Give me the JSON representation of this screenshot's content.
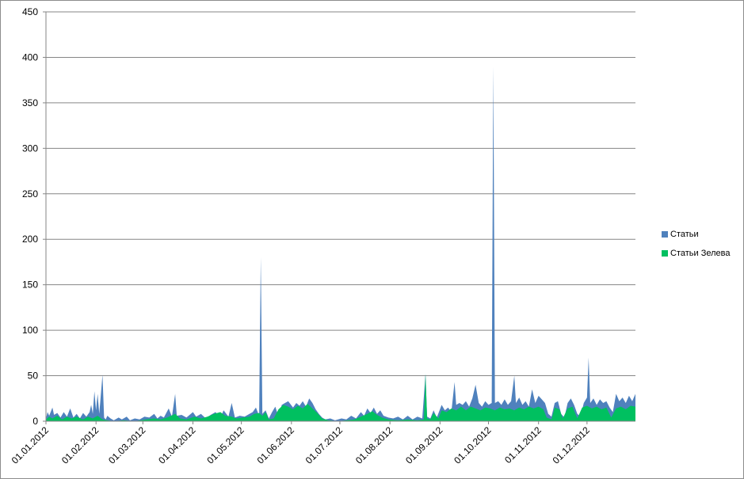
{
  "chart_data": {
    "type": "area",
    "title": "",
    "xlabel": "",
    "ylabel": "",
    "ylim": [
      0,
      450
    ],
    "yticks": [
      0,
      50,
      100,
      150,
      200,
      250,
      300,
      350,
      400,
      450
    ],
    "xlim": [
      "2012-01-01",
      "2012-12-31"
    ],
    "xticks": [
      "01.01.2012",
      "01.02.2012",
      "01.03.2012",
      "01.04.2012",
      "01.05.2012",
      "01.06.2012",
      "01.07.2012",
      "01.08.2012",
      "01.09.2012",
      "01.10.2012",
      "01.11.2012",
      "01.12.2012"
    ],
    "grid": true,
    "legend_position": "right",
    "series": [
      {
        "name": "Статьи",
        "color": "#4f81bd",
        "points": [
          [
            "2012-01-01",
            3
          ],
          [
            "2012-01-02",
            10
          ],
          [
            "2012-01-03",
            6
          ],
          [
            "2012-01-05",
            15
          ],
          [
            "2012-01-06",
            7
          ],
          [
            "2012-01-08",
            9
          ],
          [
            "2012-01-10",
            4
          ],
          [
            "2012-01-12",
            10
          ],
          [
            "2012-01-14",
            5
          ],
          [
            "2012-01-16",
            14
          ],
          [
            "2012-01-18",
            4
          ],
          [
            "2012-01-20",
            8
          ],
          [
            "2012-01-22",
            3
          ],
          [
            "2012-01-24",
            9
          ],
          [
            "2012-01-26",
            5
          ],
          [
            "2012-01-28",
            10
          ],
          [
            "2012-01-29",
            18
          ],
          [
            "2012-01-30",
            8
          ],
          [
            "2012-01-31",
            33
          ],
          [
            "2012-02-01",
            12
          ],
          [
            "2012-02-02",
            30
          ],
          [
            "2012-02-03",
            8
          ],
          [
            "2012-02-05",
            51
          ],
          [
            "2012-02-06",
            4
          ],
          [
            "2012-02-07",
            2
          ],
          [
            "2012-02-08",
            6
          ],
          [
            "2012-02-10",
            3
          ],
          [
            "2012-02-12",
            1
          ],
          [
            "2012-02-15",
            4
          ],
          [
            "2012-02-17",
            2
          ],
          [
            "2012-02-20",
            5
          ],
          [
            "2012-02-22",
            1
          ],
          [
            "2012-02-25",
            3
          ],
          [
            "2012-02-28",
            2
          ],
          [
            "2012-03-02",
            5
          ],
          [
            "2012-03-05",
            4
          ],
          [
            "2012-03-08",
            8
          ],
          [
            "2012-03-10",
            3
          ],
          [
            "2012-03-12",
            6
          ],
          [
            "2012-03-14",
            4
          ],
          [
            "2012-03-17",
            14
          ],
          [
            "2012-03-19",
            5
          ],
          [
            "2012-03-21",
            30
          ],
          [
            "2012-03-22",
            6
          ],
          [
            "2012-03-25",
            7
          ],
          [
            "2012-03-28",
            4
          ],
          [
            "2012-04-01",
            10
          ],
          [
            "2012-04-03",
            5
          ],
          [
            "2012-04-06",
            8
          ],
          [
            "2012-04-09",
            3
          ],
          [
            "2012-04-12",
            7
          ],
          [
            "2012-04-15",
            10
          ],
          [
            "2012-04-18",
            4
          ],
          [
            "2012-04-20",
            12
          ],
          [
            "2012-04-23",
            5
          ],
          [
            "2012-04-25",
            20
          ],
          [
            "2012-04-27",
            4
          ],
          [
            "2012-04-30",
            6
          ],
          [
            "2012-05-03",
            5
          ],
          [
            "2012-05-06",
            8
          ],
          [
            "2012-05-08",
            10
          ],
          [
            "2012-05-10",
            15
          ],
          [
            "2012-05-12",
            6
          ],
          [
            "2012-05-13",
            180
          ],
          [
            "2012-05-14",
            8
          ],
          [
            "2012-05-16",
            12
          ],
          [
            "2012-05-18",
            3
          ],
          [
            "2012-05-20",
            10
          ],
          [
            "2012-05-22",
            16
          ],
          [
            "2012-05-24",
            5
          ],
          [
            "2012-05-26",
            18
          ],
          [
            "2012-05-28",
            20
          ],
          [
            "2012-05-30",
            22
          ],
          [
            "2012-06-02",
            15
          ],
          [
            "2012-06-04",
            20
          ],
          [
            "2012-06-06",
            17
          ],
          [
            "2012-06-08",
            22
          ],
          [
            "2012-06-10",
            16
          ],
          [
            "2012-06-12",
            25
          ],
          [
            "2012-06-14",
            20
          ],
          [
            "2012-06-16",
            13
          ],
          [
            "2012-06-18",
            8
          ],
          [
            "2012-06-20",
            4
          ],
          [
            "2012-06-22",
            2
          ],
          [
            "2012-06-25",
            3
          ],
          [
            "2012-06-28",
            1
          ],
          [
            "2012-07-02",
            3
          ],
          [
            "2012-07-05",
            2
          ],
          [
            "2012-07-08",
            6
          ],
          [
            "2012-07-11",
            3
          ],
          [
            "2012-07-14",
            10
          ],
          [
            "2012-07-16",
            6
          ],
          [
            "2012-07-18",
            14
          ],
          [
            "2012-07-20",
            9
          ],
          [
            "2012-07-22",
            15
          ],
          [
            "2012-07-24",
            8
          ],
          [
            "2012-07-26",
            12
          ],
          [
            "2012-07-28",
            6
          ],
          [
            "2012-07-31",
            4
          ],
          [
            "2012-08-03",
            3
          ],
          [
            "2012-08-06",
            5
          ],
          [
            "2012-08-09",
            2
          ],
          [
            "2012-08-12",
            6
          ],
          [
            "2012-08-15",
            2
          ],
          [
            "2012-08-18",
            5
          ],
          [
            "2012-08-21",
            3
          ],
          [
            "2012-08-23",
            52
          ],
          [
            "2012-08-24",
            5
          ],
          [
            "2012-08-26",
            3
          ],
          [
            "2012-08-28",
            12
          ],
          [
            "2012-08-30",
            4
          ],
          [
            "2012-09-02",
            18
          ],
          [
            "2012-09-04",
            12
          ],
          [
            "2012-09-06",
            15
          ],
          [
            "2012-09-08",
            10
          ],
          [
            "2012-09-10",
            43
          ],
          [
            "2012-09-11",
            18
          ],
          [
            "2012-09-13",
            20
          ],
          [
            "2012-09-15",
            18
          ],
          [
            "2012-09-17",
            22
          ],
          [
            "2012-09-19",
            16
          ],
          [
            "2012-09-21",
            25
          ],
          [
            "2012-09-23",
            40
          ],
          [
            "2012-09-25",
            20
          ],
          [
            "2012-09-27",
            16
          ],
          [
            "2012-09-29",
            22
          ],
          [
            "2012-10-01",
            18
          ],
          [
            "2012-10-03",
            20
          ],
          [
            "2012-10-04",
            390
          ],
          [
            "2012-10-05",
            20
          ],
          [
            "2012-10-07",
            22
          ],
          [
            "2012-10-09",
            18
          ],
          [
            "2012-10-11",
            24
          ],
          [
            "2012-10-13",
            18
          ],
          [
            "2012-10-15",
            22
          ],
          [
            "2012-10-17",
            50
          ],
          [
            "2012-10-18",
            20
          ],
          [
            "2012-10-20",
            26
          ],
          [
            "2012-10-22",
            18
          ],
          [
            "2012-10-24",
            22
          ],
          [
            "2012-10-26",
            16
          ],
          [
            "2012-10-28",
            35
          ],
          [
            "2012-10-30",
            20
          ],
          [
            "2012-11-01",
            28
          ],
          [
            "2012-11-03",
            24
          ],
          [
            "2012-11-05",
            20
          ],
          [
            "2012-11-07",
            8
          ],
          [
            "2012-11-09",
            5
          ],
          [
            "2012-11-11",
            20
          ],
          [
            "2012-11-13",
            22
          ],
          [
            "2012-11-15",
            8
          ],
          [
            "2012-11-17",
            4
          ],
          [
            "2012-11-19",
            20
          ],
          [
            "2012-11-21",
            25
          ],
          [
            "2012-11-23",
            18
          ],
          [
            "2012-11-25",
            8
          ],
          [
            "2012-11-27",
            5
          ],
          [
            "2012-11-29",
            20
          ],
          [
            "2012-12-01",
            26
          ],
          [
            "2012-12-02",
            70
          ],
          [
            "2012-12-03",
            20
          ],
          [
            "2012-12-05",
            25
          ],
          [
            "2012-12-07",
            18
          ],
          [
            "2012-12-09",
            24
          ],
          [
            "2012-12-11",
            20
          ],
          [
            "2012-12-13",
            22
          ],
          [
            "2012-12-15",
            15
          ],
          [
            "2012-12-17",
            10
          ],
          [
            "2012-12-19",
            30
          ],
          [
            "2012-12-21",
            22
          ],
          [
            "2012-12-23",
            26
          ],
          [
            "2012-12-25",
            20
          ],
          [
            "2012-12-27",
            28
          ],
          [
            "2012-12-29",
            22
          ],
          [
            "2012-12-31",
            30
          ]
        ]
      },
      {
        "name": "Статьи Зелева",
        "color": "#00c060",
        "points": [
          [
            "2012-01-01",
            2
          ],
          [
            "2012-01-03",
            5
          ],
          [
            "2012-01-05",
            3
          ],
          [
            "2012-01-08",
            6
          ],
          [
            "2012-01-11",
            2
          ],
          [
            "2012-01-14",
            5
          ],
          [
            "2012-01-17",
            3
          ],
          [
            "2012-01-20",
            5
          ],
          [
            "2012-01-24",
            2
          ],
          [
            "2012-01-27",
            5
          ],
          [
            "2012-01-30",
            3
          ],
          [
            "2012-02-02",
            6
          ],
          [
            "2012-02-05",
            2
          ],
          [
            "2012-02-08",
            1
          ],
          [
            "2012-02-12",
            0
          ],
          [
            "2012-02-18",
            1
          ],
          [
            "2012-02-25",
            0
          ],
          [
            "2012-03-03",
            2
          ],
          [
            "2012-03-08",
            3
          ],
          [
            "2012-03-12",
            2
          ],
          [
            "2012-03-16",
            4
          ],
          [
            "2012-03-21",
            8
          ],
          [
            "2012-03-24",
            3
          ],
          [
            "2012-03-28",
            2
          ],
          [
            "2012-04-02",
            5
          ],
          [
            "2012-04-06",
            3
          ],
          [
            "2012-04-10",
            5
          ],
          [
            "2012-04-14",
            8
          ],
          [
            "2012-04-18",
            10
          ],
          [
            "2012-04-21",
            6
          ],
          [
            "2012-04-25",
            5
          ],
          [
            "2012-04-28",
            3
          ],
          [
            "2012-05-02",
            4
          ],
          [
            "2012-05-06",
            5
          ],
          [
            "2012-05-09",
            8
          ],
          [
            "2012-05-12",
            9
          ],
          [
            "2012-05-14",
            6
          ],
          [
            "2012-05-16",
            10
          ],
          [
            "2012-05-18",
            2
          ],
          [
            "2012-05-21",
            3
          ],
          [
            "2012-05-24",
            13
          ],
          [
            "2012-05-27",
            18
          ],
          [
            "2012-05-30",
            16
          ],
          [
            "2012-06-02",
            13
          ],
          [
            "2012-06-05",
            17
          ],
          [
            "2012-06-08",
            14
          ],
          [
            "2012-06-11",
            19
          ],
          [
            "2012-06-14",
            14
          ],
          [
            "2012-06-17",
            9
          ],
          [
            "2012-06-20",
            3
          ],
          [
            "2012-06-24",
            1
          ],
          [
            "2012-06-30",
            0
          ],
          [
            "2012-07-05",
            1
          ],
          [
            "2012-07-10",
            2
          ],
          [
            "2012-07-14",
            5
          ],
          [
            "2012-07-18",
            8
          ],
          [
            "2012-07-21",
            11
          ],
          [
            "2012-07-24",
            7
          ],
          [
            "2012-07-27",
            4
          ],
          [
            "2012-07-31",
            2
          ],
          [
            "2012-08-06",
            1
          ],
          [
            "2012-08-12",
            2
          ],
          [
            "2012-08-18",
            1
          ],
          [
            "2012-08-22",
            2
          ],
          [
            "2012-08-23",
            52
          ],
          [
            "2012-08-24",
            3
          ],
          [
            "2012-08-26",
            2
          ],
          [
            "2012-08-28",
            9
          ],
          [
            "2012-08-31",
            3
          ],
          [
            "2012-09-02",
            12
          ],
          [
            "2012-09-05",
            10
          ],
          [
            "2012-09-08",
            14
          ],
          [
            "2012-09-11",
            12
          ],
          [
            "2012-09-14",
            16
          ],
          [
            "2012-09-17",
            12
          ],
          [
            "2012-09-20",
            16
          ],
          [
            "2012-09-23",
            14
          ],
          [
            "2012-09-26",
            12
          ],
          [
            "2012-09-29",
            15
          ],
          [
            "2012-10-02",
            14
          ],
          [
            "2012-10-05",
            12
          ],
          [
            "2012-10-08",
            15
          ],
          [
            "2012-10-11",
            13
          ],
          [
            "2012-10-14",
            14
          ],
          [
            "2012-10-17",
            12
          ],
          [
            "2012-10-20",
            15
          ],
          [
            "2012-10-23",
            13
          ],
          [
            "2012-10-26",
            16
          ],
          [
            "2012-10-29",
            14
          ],
          [
            "2012-11-01",
            16
          ],
          [
            "2012-11-04",
            13
          ],
          [
            "2012-11-06",
            4
          ],
          [
            "2012-11-09",
            2
          ],
          [
            "2012-11-11",
            15
          ],
          [
            "2012-11-14",
            13
          ],
          [
            "2012-11-16",
            3
          ],
          [
            "2012-11-19",
            14
          ],
          [
            "2012-11-22",
            16
          ],
          [
            "2012-11-25",
            3
          ],
          [
            "2012-11-28",
            15
          ],
          [
            "2012-12-01",
            17
          ],
          [
            "2012-12-04",
            14
          ],
          [
            "2012-12-07",
            16
          ],
          [
            "2012-12-10",
            13
          ],
          [
            "2012-12-13",
            15
          ],
          [
            "2012-12-16",
            4
          ],
          [
            "2012-12-19",
            14
          ],
          [
            "2012-12-22",
            16
          ],
          [
            "2012-12-25",
            13
          ],
          [
            "2012-12-28",
            17
          ],
          [
            "2012-12-31",
            16
          ]
        ]
      }
    ]
  }
}
